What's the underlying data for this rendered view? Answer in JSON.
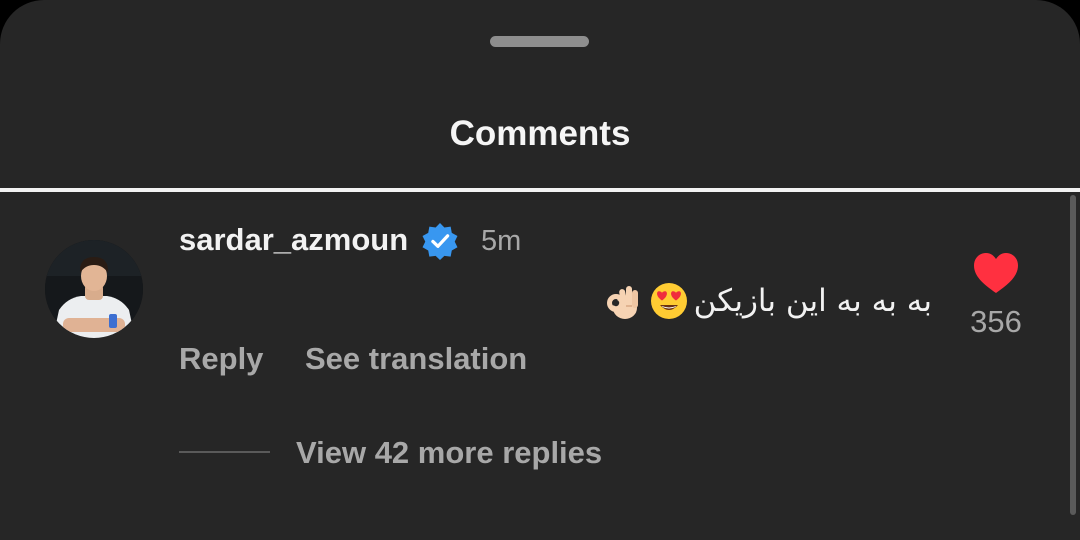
{
  "sheet": {
    "title": "Comments"
  },
  "comment": {
    "username": "sardar_azmoun",
    "verified": true,
    "timestamp": "5m",
    "text": "به به به این بازیکن",
    "emojis": [
      "heart-eyes-icon",
      "ok-hand-icon"
    ],
    "likes": "356",
    "liked": true,
    "reply_label": "Reply",
    "translation_label": "See translation",
    "view_replies_label": "View 42 more replies"
  },
  "colors": {
    "background": "#262626",
    "text_primary": "#f2f2f2",
    "text_secondary": "#a8a8a8",
    "verified_badge": "#3897f0",
    "like_heart": "#ff3040"
  }
}
